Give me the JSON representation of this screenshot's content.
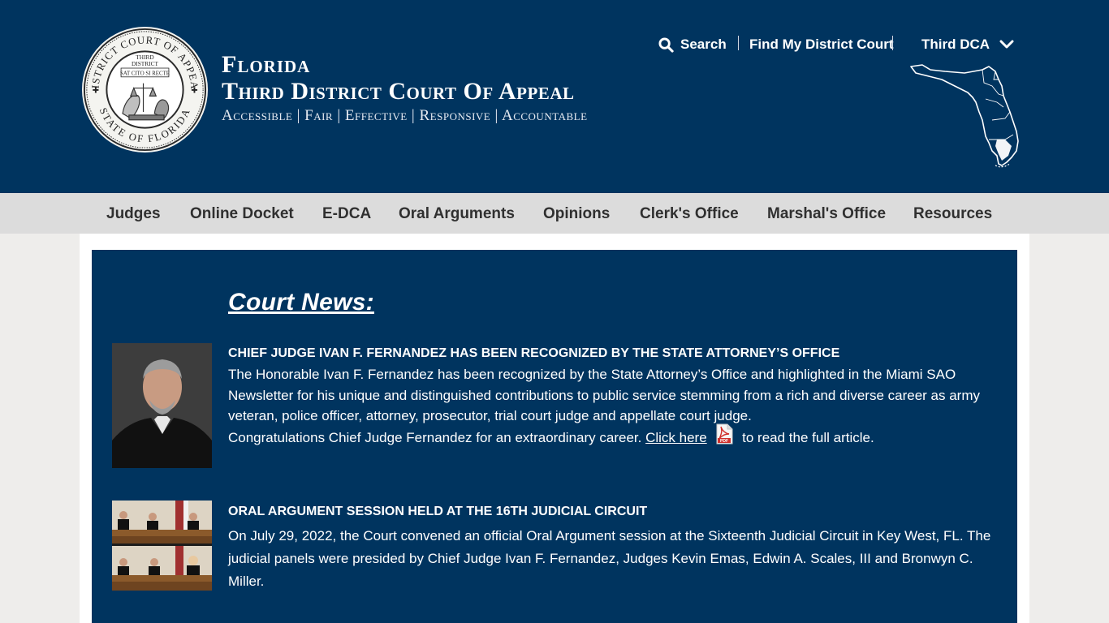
{
  "header": {
    "seal_text": {
      "ring_top": "DISTRICT COURT OF APPEAL",
      "ring_bottom": "STATE OF FLORIDA",
      "center_line1": "THIRD",
      "center_line2": "DISTRICT",
      "motto": "SAT CITO SI RECTE"
    },
    "title_line1": "Florida",
    "title_line2": "Third District Court Of Appeal",
    "tagline": "Accessible | Fair | Effective | Responsive | Accountable",
    "search_label": "Search",
    "find_court_label": "Find My District Court",
    "district_label": "Third DCA",
    "icons": {
      "search": "search-icon",
      "dropdown": "chevron-down-icon",
      "map": "florida-map-icon",
      "seal": "court-seal-logo"
    }
  },
  "nav": {
    "items": [
      {
        "label": "Judges"
      },
      {
        "label": "Online Docket"
      },
      {
        "label": "E-DCA"
      },
      {
        "label": "Oral Arguments"
      },
      {
        "label": "Opinions"
      },
      {
        "label": "Clerk's Office"
      },
      {
        "label": "Marshal's Office"
      },
      {
        "label": "Resources"
      }
    ]
  },
  "news": {
    "heading": "Court News:",
    "items": [
      {
        "title": "CHIEF JUDGE IVAN F. FERNANDEZ HAS BEEN RECOGNIZED BY THE STATE ATTORNEY’S OFFICE",
        "body": "The Honorable Ivan F. Fernandez has been recognized by the State Attorney’s Office and highlighted in the Miami SAO Newsletter for his unique and distinguished contributions to public service stemming from a rich and diverse career as army veteran, police officer, attorney, prosecutor, trial court judge and appellate court judge.",
        "congrats": "Congratulations Chief Judge Fernandez for an extraordinary career.",
        "link_label": "Click here",
        "pdf_label": "PDF",
        "after_link": "to read the full article."
      },
      {
        "title": "ORAL ARGUMENT SESSION HELD AT THE 16TH JUDICIAL CIRCUIT",
        "body": "On July 29, 2022, the Court convened an official Oral Argument session at the Sixteenth Judicial Circuit in Key West, FL.  The judicial panels were presided by Chief Judge Ivan F. Fernandez, Judges Kevin Emas, Edwin A. Scales, III and Bronwyn C. Miller."
      }
    ]
  },
  "colors": {
    "brand_navy": "#00345f",
    "nav_bg": "#dcdcdc",
    "page_bg": "#eeedeb"
  }
}
